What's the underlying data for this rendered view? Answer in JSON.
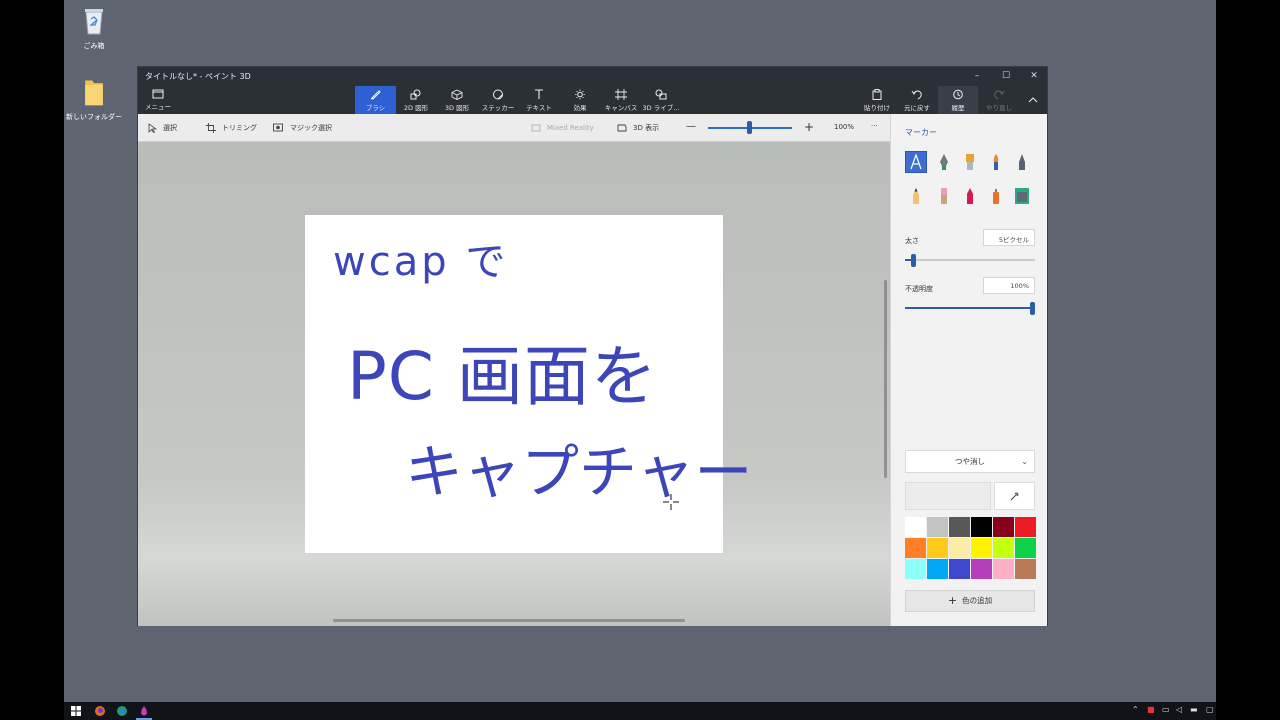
{
  "desktop": {
    "icons": [
      {
        "label": "ごみ箱",
        "icon": "recycle-bin-icon"
      },
      {
        "label": "新しいフォルダー",
        "icon": "folder-icon"
      }
    ]
  },
  "window": {
    "title": "タイトルなし* - ペイント 3D",
    "controls": {
      "minimize": "–",
      "maximize": "☐",
      "close": "✕"
    }
  },
  "ribbon": {
    "menu": "メニュー",
    "tools": [
      {
        "label": "ブラシ",
        "icon": "brush-icon",
        "active": true
      },
      {
        "label": "2D 図形",
        "icon": "2d-shapes-icon"
      },
      {
        "label": "3D 図形",
        "icon": "3d-shapes-icon"
      },
      {
        "label": "ステッカー",
        "icon": "sticker-icon"
      },
      {
        "label": "テキスト",
        "icon": "text-icon"
      },
      {
        "label": "効果",
        "icon": "effects-icon"
      },
      {
        "label": "キャンバス",
        "icon": "canvas-icon"
      },
      {
        "label": "3D ライブ...",
        "icon": "3d-library-icon"
      }
    ],
    "right": [
      {
        "label": "貼り付け",
        "icon": "paste-icon"
      },
      {
        "label": "元に戻す",
        "icon": "undo-icon"
      },
      {
        "label": "履歴",
        "icon": "history-icon"
      },
      {
        "label": "やり直し",
        "icon": "redo-icon"
      }
    ]
  },
  "toolbar": {
    "select": "選択",
    "crop": "トリミング",
    "magic_select": "マジック選択",
    "mixed_reality": "Mixed Reality",
    "view3d": "3D 表示",
    "zoom_minus": "—",
    "zoom_plus": "+",
    "zoom": "100%",
    "more": "···"
  },
  "canvas": {
    "line1": "wcap で",
    "line2": "PC 画面を",
    "line3": "キャプチャー",
    "ink_color": "#3c46b8"
  },
  "panel": {
    "title": "マーカー",
    "thickness_label": "太さ",
    "thickness_value": "5ピクセル",
    "thickness_level": 0.05,
    "opacity_label": "不透明度",
    "opacity_value": "100%",
    "opacity_level": 1.0,
    "finish": "つや消し",
    "add_color": "色の追加",
    "palette": [
      "#ffffff",
      "#c3c3c3",
      "#585858",
      "#000000",
      "#88001b",
      "#ec1c24",
      "#ff7f27",
      "#ffca18",
      "#fdeca6",
      "#fff200",
      "#c4ff0e",
      "#0ed145",
      "#8cfffb",
      "#00a8f3",
      "#3f48cc",
      "#b83dba",
      "#ffaec8",
      "#b97a56"
    ]
  },
  "taskbar": {
    "tray_icons": [
      "chevron-up-icon",
      "camera-icon",
      "network-icon",
      "speaker-icon",
      "battery-icon",
      "notification-icon"
    ]
  }
}
